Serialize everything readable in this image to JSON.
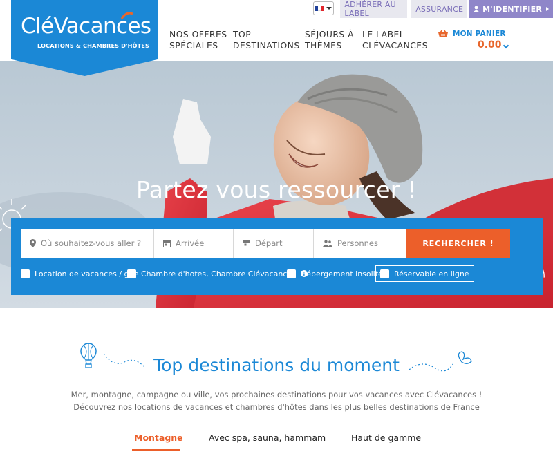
{
  "header": {
    "logo_text": "CléVacances",
    "logo_subtitle": "LOCATIONS & CHAMBRES D'HÔTES",
    "top_links": [
      {
        "label": "ADHÉRER AU LABEL"
      },
      {
        "label": "ASSURANCE"
      },
      {
        "label": "M'IDENTIFIER"
      }
    ],
    "language": {
      "flag_colors": [
        "#1f3f99",
        "#ffffff",
        "#e1242a"
      ]
    },
    "nav": [
      {
        "line1": "NOS OFFRES",
        "line2": "SPÉCIALES"
      },
      {
        "line1": "TOP",
        "line2": "DESTINATIONS"
      },
      {
        "line1": "SÉJOURS À",
        "line2": "THÈMES"
      },
      {
        "line1": "LE LABEL",
        "line2": "CLÉVACANCES"
      }
    ],
    "cart": {
      "label": "MON PANIER",
      "amount": "0.00"
    }
  },
  "hero": {
    "title": "Partez vous ressourcer !",
    "search": {
      "destination_placeholder": "Où souhaitez-vous aller ?",
      "arrival_placeholder": "Arrivée",
      "departure_placeholder": "Départ",
      "persons_placeholder": "Personnes",
      "button_label": "RECHERCHER !"
    },
    "filters": [
      {
        "label": "Location de vacances / gîte",
        "checked": false
      },
      {
        "label": "Chambre d'hotes, Chambre Clévacances",
        "checked": false
      },
      {
        "label": "Hébergement insolite",
        "checked": false
      },
      {
        "label": "Réservable en ligne",
        "checked": false
      }
    ]
  },
  "section": {
    "title": "Top destinations du moment",
    "description_line1": "Mer, montagne, campagne ou ville, vos prochaines destinations pour vos vacances avec Clévacances !",
    "description_line2": "Découvrez nos locations de vacances et chambres d'hôtes dans les plus belles destinations de France",
    "tabs": [
      {
        "label": "Montagne",
        "active": true
      },
      {
        "label": "Avec spa, sauna, hammam",
        "active": false
      },
      {
        "label": "Haut de gamme",
        "active": false
      }
    ]
  },
  "colors": {
    "brand_blue": "#1b88d6",
    "accent_orange": "#ec5f2a",
    "login_purple": "#8f86c9",
    "link_purple": "#7a6eb8"
  }
}
